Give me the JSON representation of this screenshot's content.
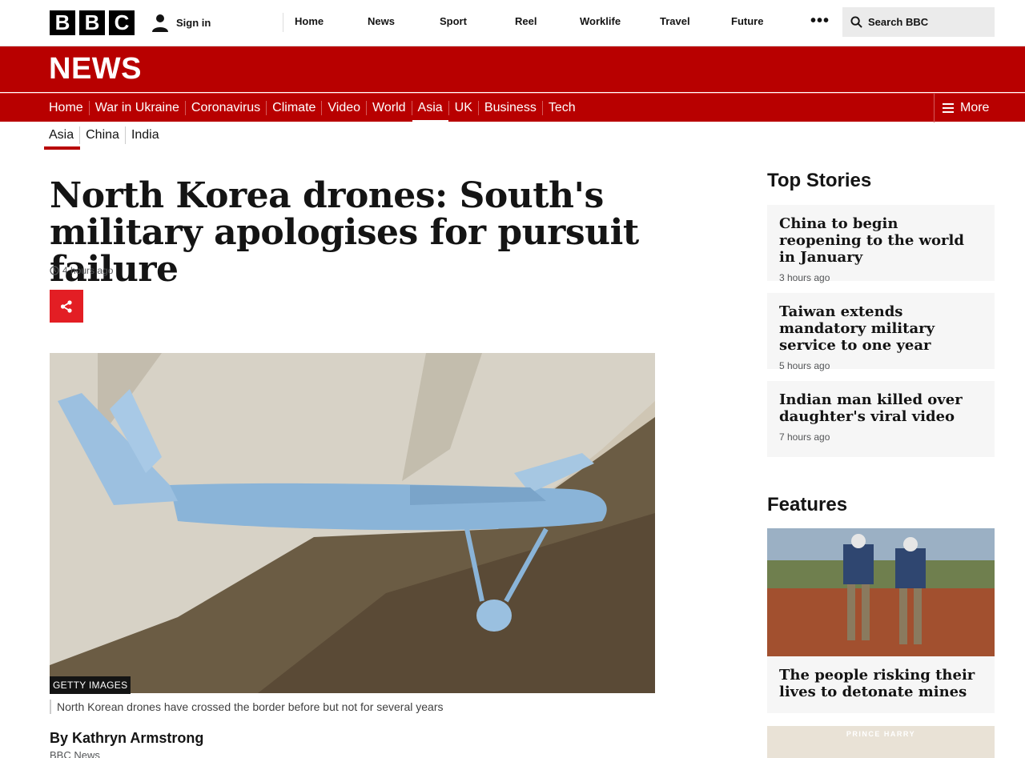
{
  "brand": {
    "letters": [
      "B",
      "B",
      "C"
    ]
  },
  "topbar": {
    "sign_in": "Sign in",
    "nav": [
      "Home",
      "News",
      "Sport",
      "Reel",
      "Worklife",
      "Travel",
      "Future"
    ],
    "more_dots": "•••",
    "search_placeholder": "Search BBC"
  },
  "masthead": {
    "title": "NEWS"
  },
  "news_nav": {
    "items": [
      "Home",
      "War in Ukraine",
      "Coronavirus",
      "Climate",
      "Video",
      "World",
      "Asia",
      "UK",
      "Business",
      "Tech"
    ],
    "active": "Asia",
    "more_label": "More"
  },
  "sub_nav": {
    "items": [
      "Asia",
      "China",
      "India"
    ],
    "active": "Asia"
  },
  "article": {
    "headline": "North Korea drones: South's military apologises for pursuit failure",
    "timestamp": "4 hours ago",
    "image_credit": "GETTY IMAGES",
    "caption": "North Korean drones have crossed the border before but not for several years",
    "byline": "By Kathryn Armstrong",
    "organisation": "BBC News"
  },
  "sidebar": {
    "top_stories_heading": "Top Stories",
    "top_stories": [
      {
        "title": "China to begin reopening to the world in January",
        "age": "3 hours ago"
      },
      {
        "title": "Taiwan extends mandatory military service to one year",
        "age": "5 hours ago"
      },
      {
        "title": "Indian man killed over daughter's viral video",
        "age": "7 hours ago"
      }
    ],
    "features_heading": "Features",
    "features": [
      {
        "title": "The people risking their lives to detonate mines"
      },
      {
        "image_label": "PRINCE HARRY"
      }
    ]
  },
  "colors": {
    "bbc_red": "#b80000",
    "share_red": "#e31e24",
    "card_bg": "#f6f6f6"
  }
}
